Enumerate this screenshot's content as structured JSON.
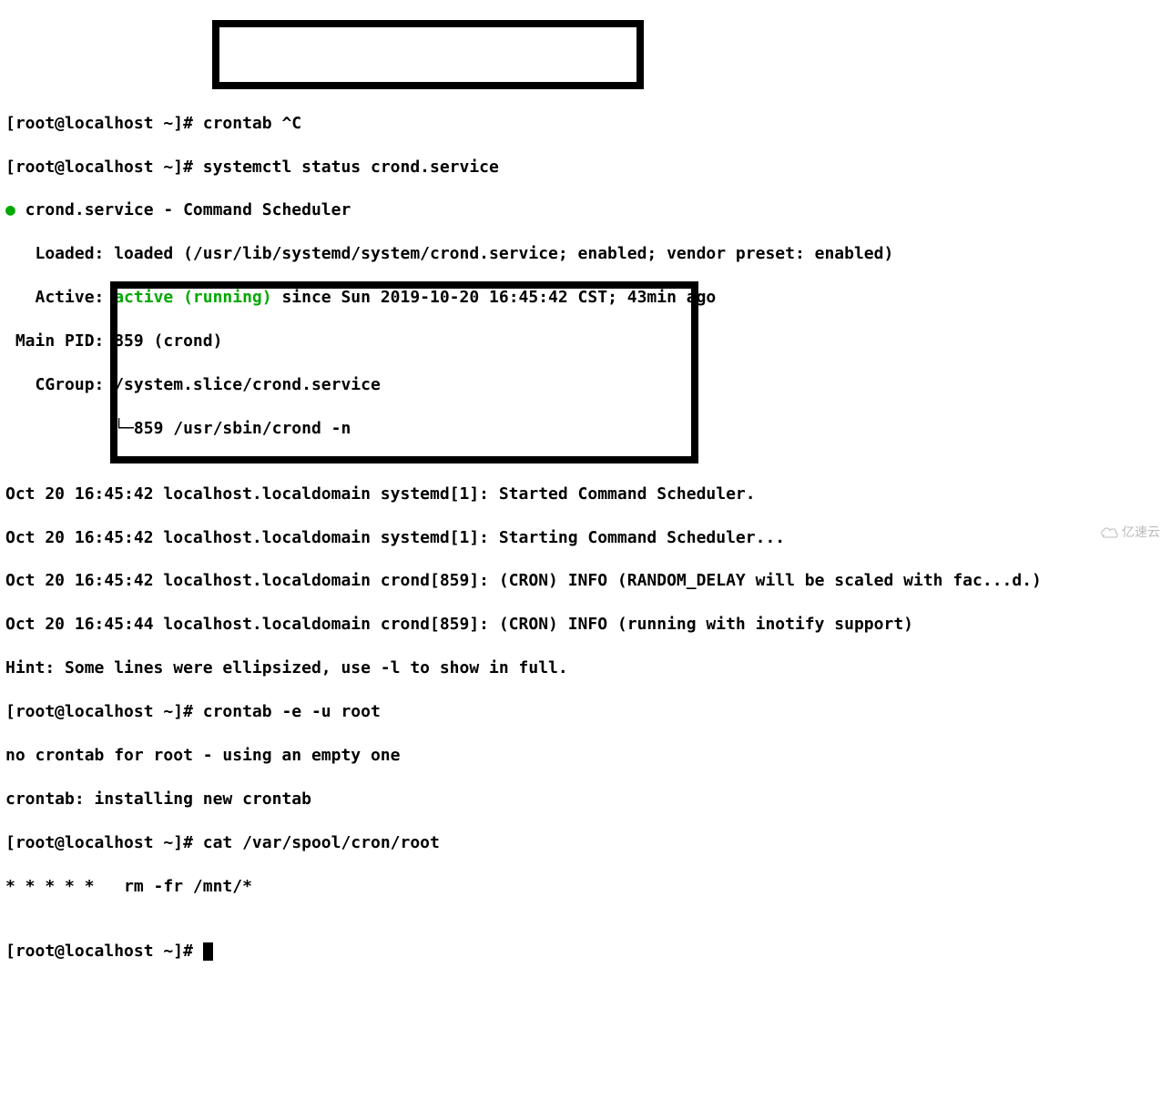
{
  "prompt": "[root@localhost ~]# ",
  "lines": {
    "l0_cmd": "crontab ^C",
    "l1_cmd": "systemctl status crond.service",
    "l2_bullet": "●",
    "l2_text": " crond.service - Command Scheduler",
    "l3": "   Loaded: loaded (/usr/lib/systemd/system/crond.service; enabled; vendor preset: enabled)",
    "l4_pre": "   Active: ",
    "l4_active": "active (running)",
    "l4_post": " since Sun 2019-10-20 16:45:42 CST; 43min ago",
    "l5": " Main PID: 859 (crond)",
    "l6": "   CGroup: /system.slice/crond.service",
    "l7_tree": "           └─",
    "l7_text": "859 /usr/sbin/crond -n",
    "l8": "",
    "l9": "Oct 20 16:45:42 localhost.localdomain systemd[1]: Started Command Scheduler.",
    "l10": "Oct 20 16:45:42 localhost.localdomain systemd[1]: Starting Command Scheduler...",
    "l11": "Oct 20 16:45:42 localhost.localdomain crond[859]: (CRON) INFO (RANDOM_DELAY will be scaled with fac...d.)",
    "l12": "Oct 20 16:45:44 localhost.localdomain crond[859]: (CRON) INFO (running with inotify support)",
    "l13": "Hint: Some lines were ellipsized, use -l to show in full.",
    "l14_cmd": "crontab -e -u root",
    "l15": "no crontab for root - using an empty one",
    "l16": "crontab: installing new crontab",
    "l17_cmd": "cat /var/spool/cron/root",
    "l18": "* * * * *   rm -fr /mnt/*",
    "l19": ""
  },
  "watermark": "亿速云"
}
